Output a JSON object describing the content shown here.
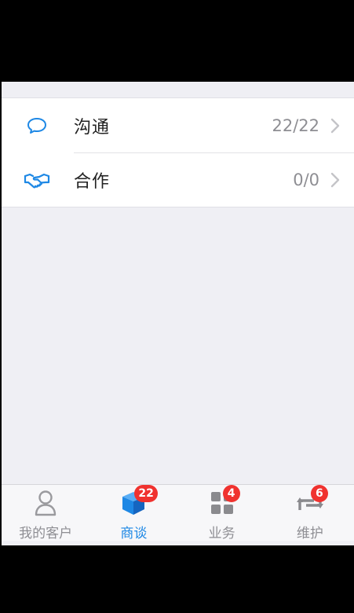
{
  "list": {
    "items": [
      {
        "label": "沟通",
        "count": "22/22",
        "icon": "chat-bubble-icon"
      },
      {
        "label": "合作",
        "count": "0/0",
        "icon": "handshake-icon"
      }
    ]
  },
  "tabbar": {
    "tabs": [
      {
        "label": "我的客户",
        "icon": "person-icon",
        "badge": ""
      },
      {
        "label": "商谈",
        "icon": "cube-icon",
        "badge": "22",
        "active": true
      },
      {
        "label": "业务",
        "icon": "grid-icon",
        "badge": "4"
      },
      {
        "label": "维护",
        "icon": "repeat-icon",
        "badge": "6"
      }
    ]
  },
  "colors": {
    "accent": "#1e88e5",
    "badge": "#f0322f",
    "background": "#efeff4"
  }
}
